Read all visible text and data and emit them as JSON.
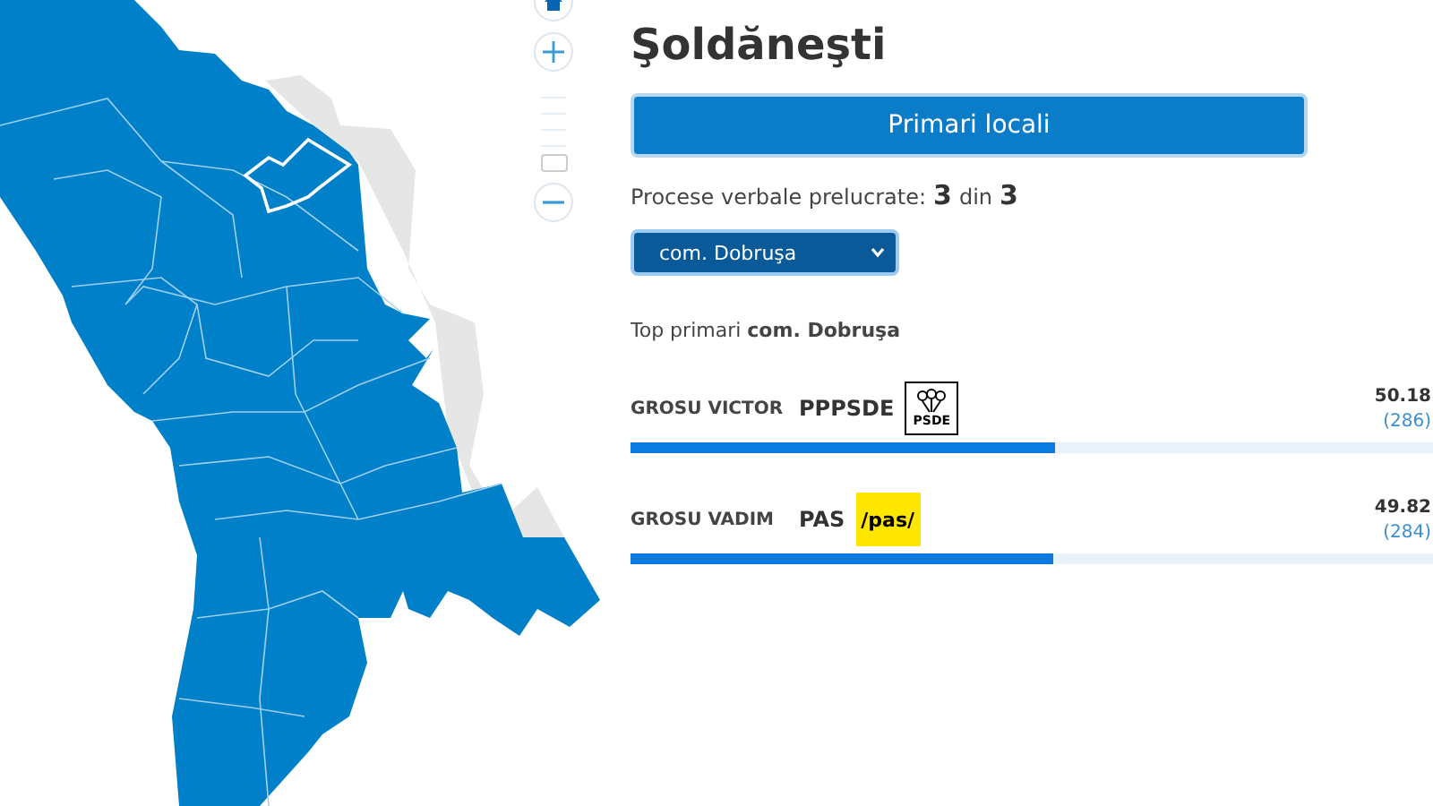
{
  "map_zoom": {
    "level": 0
  },
  "title": "Şoldăneşti",
  "mode_button": {
    "label": "Primari locali"
  },
  "processed": {
    "label": "Procese verbale prelucrate:",
    "done": "3",
    "separator": "din",
    "total": "3"
  },
  "locality_select": {
    "value": "com. Dobruşa"
  },
  "top_heading": {
    "label": "Top primari",
    "place": "com. Dobruşa"
  },
  "candidates": [
    {
      "name": "GROSU VICTOR",
      "party": "PPPSDE",
      "kind": "psde",
      "logo_text": "PSDE",
      "percent": "50.18",
      "votes": "(286)",
      "level": 0.53
    },
    {
      "name": "GROSU VADIM",
      "party": "PAS",
      "kind": "pas",
      "logo_text": "/pas/",
      "percent": "49.82",
      "votes": "(284)",
      "level": 0.527
    }
  ]
}
